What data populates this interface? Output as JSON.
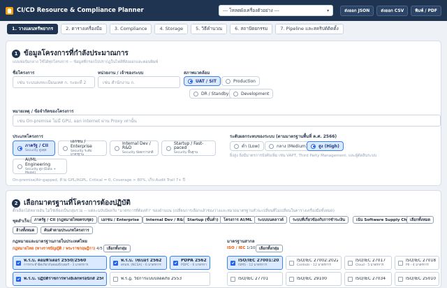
{
  "header": {
    "title": "CI/CD Resource & Compliance Planner",
    "template_select": "--- โหลดผังเครื่องตัวอย่าง ---",
    "buttons": {
      "export_json": "ส่งออก JSON",
      "export_csv": "ส่งออก CSV",
      "print_pdf": "พิมพ์ / PDF"
    }
  },
  "tabs": [
    "1. วางแผนทรัพยากร",
    "2. ตารางเครื่องมือ",
    "3. Compliance",
    "4. Storage",
    "5. วิธีคำนวณ",
    "6. สถาปัตยกรรม",
    "7. Pipeline และสคริปต์ติดตั้ง"
  ],
  "section1": {
    "number": "1",
    "title": "ข้อมูลโครงการที่กำลังประมาณการ",
    "subtitle": "แบบฟอร์มกลาง ใช้ได้ทุกโครงการ -- ข้อมูลที่กรอกไปปรากฏในไฟล์ที่ส่งออกและตอนพิมพ์",
    "project_name": {
      "label": "ชื่อโครงการ",
      "placeholder": "เช่น ระบบลงทะเบียนเทศ ก. ระยะที่ 2"
    },
    "owner": {
      "label": "หน่วยงาน / เจ้าของระบบ",
      "placeholder": "เช่น สำนักงาน ก."
    },
    "environment": {
      "label": "สภาพแวดล้อม",
      "options": [
        "UAT / SIT",
        "Production",
        "DR / Standby",
        "Development"
      ],
      "selected": "UAT / SIT"
    },
    "notes": {
      "label": "หมายเหตุ / ข้อจำกัดของโครงการ",
      "placeholder": "เช่น On-premise ไม่มี GPU, ออก internet ผ่าน Proxy เท่านั้น"
    },
    "project_type": {
      "label": "ประเภทโครงการ",
      "options": [
        {
          "title": "ภาครัฐ / CII",
          "desc": "Security สูงสุด"
        },
        {
          "title": "เอกชน / Enterprise",
          "desc": "Security ระดับมาตรฐาน"
        },
        {
          "title": "Internal Dev / R&D",
          "desc": "Security น้อยกว่าปกติ"
        },
        {
          "title": "Startup / Fast-paced",
          "desc": "Security พื้นฐาน"
        },
        {
          "title": "AI/ML Engineering",
          "desc": "Security สูง (Data + Model)"
        }
      ],
      "selected": "ภาครัฐ / CII",
      "note": "On-premise/Air-gapped, ห้าม GPL/AGPL, Critical = 0, Coverage > 80%, เก็บ Audit Trail 7+ ปี"
    },
    "risk": {
      "label": "ระดับผลกระทบของระบบ (ตามมาตรฐานพื้นที่ ค.ศ. 2566)",
      "options": [
        "ต่ำ (Low)",
        "กลาง (Medium)",
        "สูง (High)"
      ],
      "selected": "สูง (High)",
      "note": "ยิ่งสูง ยิ่งมีมาตรการบังคับเพิ่ม เช่น VAPT, Third Party Management, และผู้ตัดสินระบบ"
    }
  },
  "section2": {
    "number": "2",
    "title": "เลือกมาตรฐานที่โครงการต้องปฏิบัติ",
    "subtitle": "ติ๊กเลือกได้หลายอัน ไม่ใช่เพียงเป็นกลุ่มรวม -- แต่ละฉบับมีผลกับ \"มาตรการที่ต้องทำ\" ของด้านบน (เปลี่ยนการเลือกแล้วช่องว่างและหมวดมาตรฐานหัวจะเปลี่ยนที่ไม่เปลี่ยนในตารางเครื่องมือทั้งหมด)",
    "presets_label": "ชุดสำเร็จ:",
    "presets": [
      "ภาครัฐ / CII (กฎหมายไทยครบชุด)",
      "เอกชน / Enterprise",
      "Internal Dev / R&D",
      "Startup (ขั้นต่ำ)",
      "โครงการ AI/ML",
      "ระบบบนคลาวด์",
      "ระบบที่เกี่ยวข้องกับการชำระเงิน",
      "เน้น Software Supply Chain",
      "เลือกทั้งหมด",
      "ล้างทั้งหมด",
      "ค้นคำตามประเภทโครงการ"
    ],
    "thai_group": {
      "heading": "กฎหมายและมาตรฐานภายในประเทศไทย",
      "sub_label": "กฎหมายไทย (ทางราชบัญญัติ / พระราชกฤษฎีกา)",
      "count": "4/5",
      "select_group": "เลือกทั้งกลุ่ม",
      "items": [
        {
          "title": "พ.ร.บ. คอมพิวเตอร์ 2550/2560",
          "desc": "การกระทำผิดเกี่ยวกับคอมพิวเตอร์ - 3 มาตรการ",
          "checked": true
        },
        {
          "title": "พ.ร.บ. ไซเบอร์ 2562",
          "desc": "สกมช. (NCSA) - 6 มาตรการ",
          "checked": true
        },
        {
          "title": "PDPA 2562",
          "desc": "PDPC - 6 มาตรการ",
          "checked": true
        },
        {
          "title": "พ.ร.บ. ปฏิบัติราชการทางอิเล็กทรอนิกส์ 2565",
          "desc": "",
          "checked": true
        },
        {
          "title": "พ.ร.ฎ. วิธีการแบบปลอดภัย 2553",
          "desc": "",
          "checked": false
        }
      ]
    },
    "intl_group": {
      "heading": "มาตรฐานสากล",
      "sub_label": "ISO / IEC",
      "count": "1/10",
      "select_group": "เลือกทั้งกลุ่ม",
      "items": [
        {
          "title": "ISO/IEC 27001:2022",
          "desc": "ISMS - 12 มาตรการ",
          "checked": true
        },
        {
          "title": "ISO/IEC 27002:2022",
          "desc": "Controls - 12 มาตรการ",
          "checked": false
        },
        {
          "title": "ISO/IEC 27017",
          "desc": "Cloud - 5 มาตรการ",
          "checked": false
        },
        {
          "title": "ISO/IEC 27018",
          "desc": "PII - 4 มาตรการ",
          "checked": false
        },
        {
          "title": "ISO/IEC 27701",
          "desc": "",
          "checked": false
        },
        {
          "title": "ISO/IEC 29100",
          "desc": "",
          "checked": false
        },
        {
          "title": "ISO/IEC 27034",
          "desc": "",
          "checked": false
        },
        {
          "title": "ISO/IEC 25010:2023",
          "desc": "",
          "checked": false
        }
      ]
    }
  }
}
